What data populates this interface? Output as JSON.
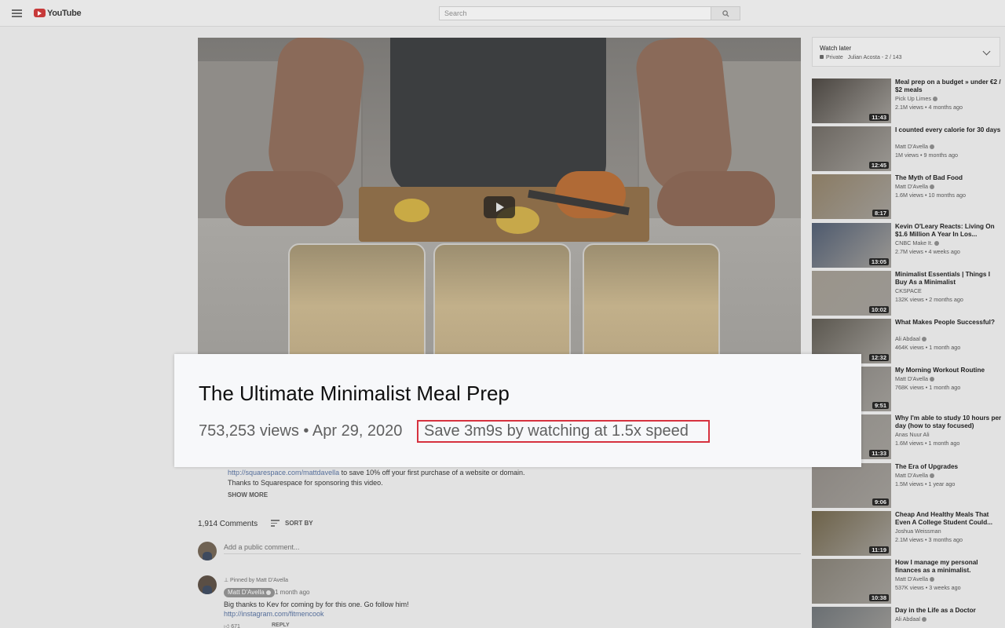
{
  "header": {
    "logo_text": "YouTube",
    "search_placeholder": "Search"
  },
  "description": {
    "link": "http://squarespace.com/mattdavella",
    "link_suffix": " to save 10% off your first purchase of a website or domain.",
    "thanks": "Thanks to Squarespace for sponsoring this video.",
    "show_more": "SHOW MORE"
  },
  "comments": {
    "count": "1,914 Comments",
    "sort_label": "SORT BY",
    "add_placeholder": "Add a public comment...",
    "pinned_label": "Pinned by Matt D'Avella",
    "author": "Matt D'Avella",
    "age": "1 month ago",
    "text": "Big thanks to Kev for coming by for this one. Go follow him!",
    "link": "http://instagram.com/fitmencook",
    "likes": "671",
    "reply_label": "REPLY"
  },
  "playlist": {
    "title": "Watch later",
    "privacy": "Private",
    "meta": "Julian Acosta - 2 / 143"
  },
  "recommendations": [
    {
      "title": "Meal prep on a budget » under €2 / $2 meals",
      "channel": "Pick Up Limes",
      "verified": true,
      "meta": "2.1M views • 4 months ago",
      "duration": "11:43",
      "color": "#4a4540"
    },
    {
      "title": "I counted every calorie for 30 days",
      "channel": "Matt D'Avella",
      "verified": true,
      "meta": "1M views • 9 months ago",
      "duration": "12:45",
      "color": "#6b6660"
    },
    {
      "title": "The Myth of Bad Food",
      "channel": "Matt D'Avella",
      "verified": true,
      "meta": "1.6M views • 10 months ago",
      "duration": "8:17",
      "color": "#8a7b63"
    },
    {
      "title": "Kevin O'Leary Reacts: Living On $1.6 Million A Year In Los...",
      "channel": "CNBC Make It.",
      "verified": true,
      "meta": "2.7M views • 4 weeks ago",
      "duration": "13:05",
      "color": "#4e5a6e"
    },
    {
      "title": "Minimalist Essentials | Things I Buy As a Minimalist",
      "channel": "CKSPACE",
      "verified": false,
      "meta": "132K views • 2 months ago",
      "duration": "10:02",
      "color": "#9a948a"
    },
    {
      "title": "What Makes People Successful?",
      "channel": "Ali Abdaal",
      "verified": true,
      "meta": "464K views • 1 month ago",
      "duration": "12:32",
      "color": "#5b574f"
    },
    {
      "title": "My Morning Workout Routine",
      "channel": "Matt D'Avella",
      "verified": true,
      "meta": "768K views • 1 month ago",
      "duration": "9:51",
      "color": "#7d7a76"
    },
    {
      "title": "Why I'm able to study 10 hours per day (how to stay focused)",
      "channel": "Anas Nuur Ali",
      "verified": false,
      "meta": "1.6M views • 1 month ago",
      "duration": "11:33",
      "color": "#8d8a85"
    },
    {
      "title": "The Era of Upgrades",
      "channel": "Matt D'Avella",
      "verified": true,
      "meta": "1.5M views • 1 year ago",
      "duration": "9:06",
      "color": "#8a8580"
    },
    {
      "title": "Cheap And Healthy Meals That Even A College Student Could...",
      "channel": "Joshua Weissman",
      "verified": false,
      "meta": "2.1M views • 3 months ago",
      "duration": "11:19",
      "color": "#6d6249"
    },
    {
      "title": "How I manage my personal finances as a minimalist.",
      "channel": "Matt D'Avella",
      "verified": true,
      "meta": "537K views • 3 weeks ago",
      "duration": "10:38",
      "color": "#7f7a70"
    },
    {
      "title": "Day in the Life as a Doctor",
      "channel": "Ali Abdaal",
      "verified": true,
      "meta": "",
      "duration": "",
      "color": "#6a6f73"
    }
  ],
  "overlay": {
    "title": "The Ultimate Minimalist Meal Prep",
    "views": "753,253 views",
    "separator": " • ",
    "date": "Apr 29, 2020",
    "save_text": "Save 3m9s by watching at 1.5x speed"
  }
}
